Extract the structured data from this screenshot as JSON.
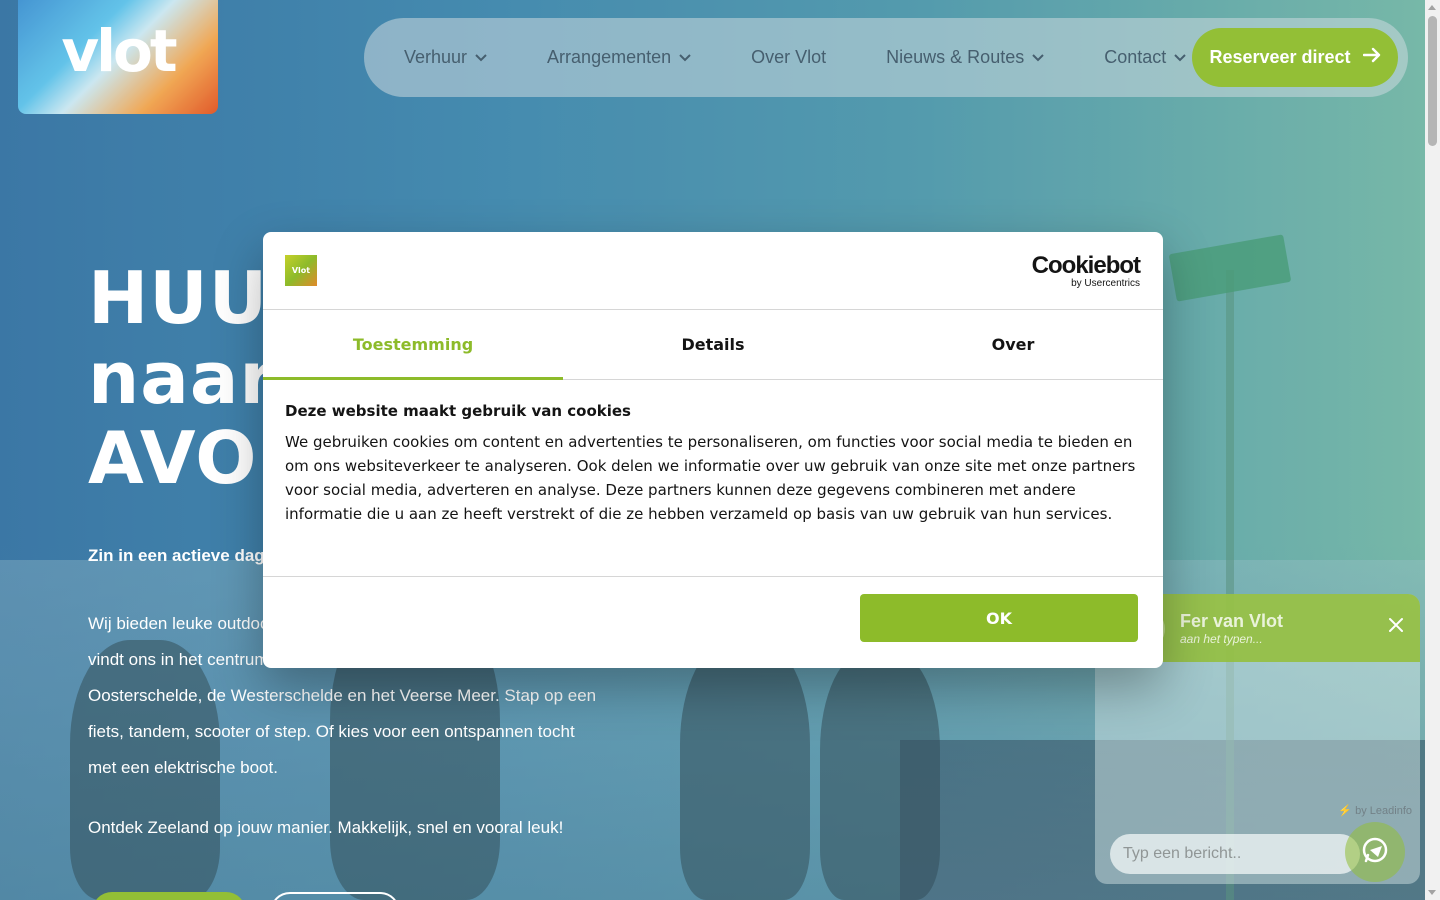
{
  "header": {
    "logo_text": "vlot",
    "nav": [
      {
        "label": "Verhuur",
        "has_dropdown": true
      },
      {
        "label": "Arrangementen",
        "has_dropdown": true
      },
      {
        "label": "Over Vlot",
        "has_dropdown": false
      },
      {
        "label": "Nieuws & Routes",
        "has_dropdown": true
      },
      {
        "label": "Contact",
        "has_dropdown": true
      }
    ],
    "cta_label": "Reserveer direct"
  },
  "hero": {
    "title_lines": [
      "HUUR",
      "naar",
      "AVON"
    ],
    "subtitle": "Zin in een actieve dag v",
    "body_lines": [
      "Wij bieden leuke outdoo",
      "vindt ons in het centrum",
      "Oosterschelde, de Westerschelde en het Veerse Meer. Stap op een",
      "fiets, tandem, scooter of step. Of kies voor een ontspannen tocht",
      "met een elektrische boot."
    ],
    "body_2": "Ontdek Zeeland op jouw manier. Makkelijk, snel en vooral leuk!"
  },
  "cookie_dialog": {
    "logo_text": "Vlot",
    "brand_name": "Cookiebot",
    "brand_by": "by Usercentrics",
    "tabs": [
      {
        "label": "Toestemming",
        "active": true
      },
      {
        "label": "Details",
        "active": false
      },
      {
        "label": "Over",
        "active": false
      }
    ],
    "heading": "Deze website maakt gebruik van cookies",
    "text": "We gebruiken cookies om content en advertenties te personaliseren, om functies voor social media te bieden en om ons websiteverkeer te analyseren. Ook delen we informatie over uw gebruik van onze site met onze partners voor social media, adverteren en analyse. Deze partners kunnen deze gegevens combineren met andere informatie die u aan ze heeft verstrekt of die ze hebben verzameld op basis van uw gebruik van hun services.",
    "ok_label": "OK"
  },
  "chat": {
    "agent_name": "Fer van Vlot",
    "status": "aan het typen...",
    "powered_by": "⚡ by Leadinfo",
    "input_placeholder": "Typ een bericht.."
  },
  "colors": {
    "accent_green": "#8dbb2a",
    "nav_text": "#3b5566",
    "dialog_text": "#141414"
  }
}
